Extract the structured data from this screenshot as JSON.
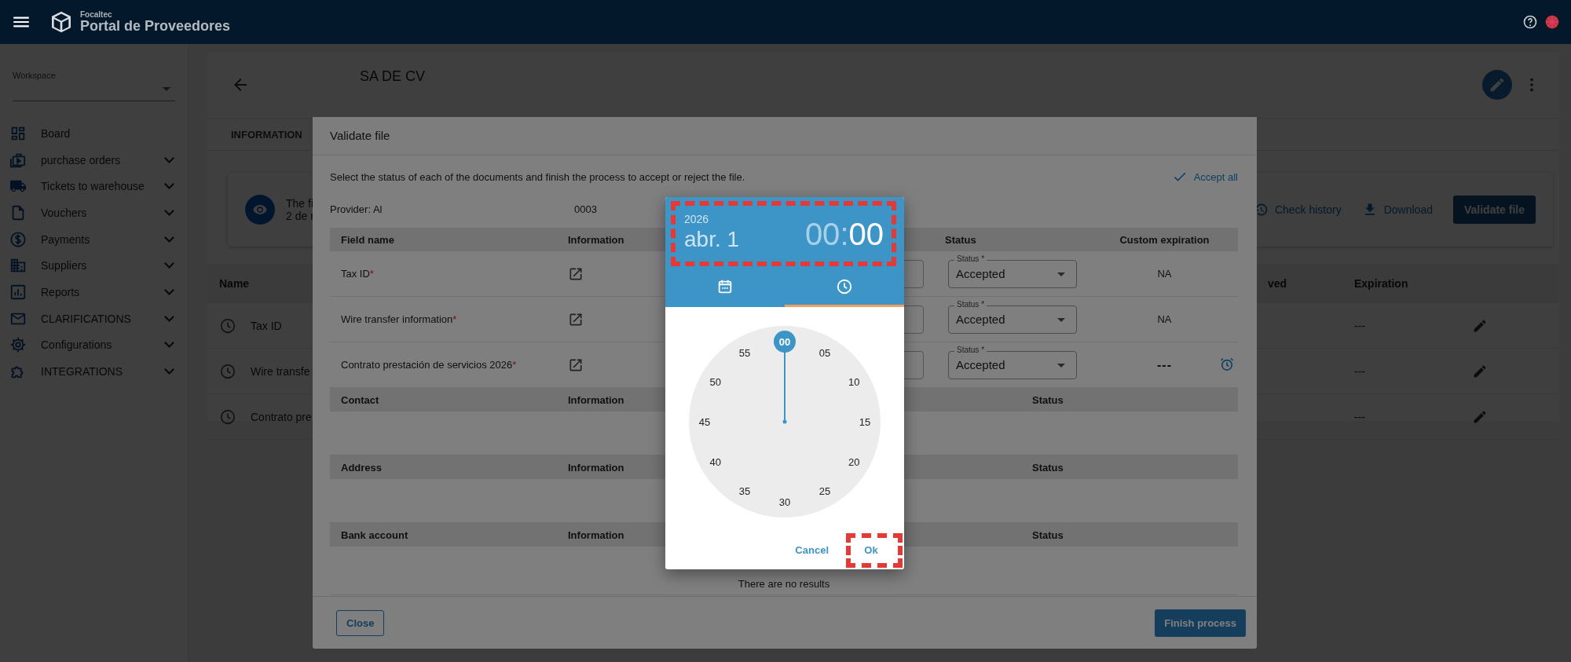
{
  "header": {
    "brand_small": "Focaltec",
    "brand": "Portal de Proveedores"
  },
  "sidebar": {
    "workspace_label": "Workspace",
    "items": [
      {
        "label": "Board",
        "expandable": false
      },
      {
        "label": "purchase orders",
        "expandable": true
      },
      {
        "label": "Tickets to warehouse",
        "expandable": true
      },
      {
        "label": "Vouchers",
        "expandable": true
      },
      {
        "label": "Payments",
        "expandable": true
      },
      {
        "label": "Suppliers",
        "expandable": true
      },
      {
        "label": "Reports",
        "expandable": true
      },
      {
        "label": "CLARIFICATIONS",
        "expandable": true
      },
      {
        "label": "Configurations",
        "expandable": true
      },
      {
        "label": "INTEGRATIONS",
        "expandable": true
      }
    ]
  },
  "page": {
    "title": "SA DE CV",
    "tabs": [
      {
        "label": "INFORMATION"
      }
    ],
    "notice": {
      "line_1": "The fi",
      "line_2": "2 de r"
    },
    "check_history": "Check history",
    "download": "Download",
    "validate_button": "Validate file",
    "table": {
      "columns": [
        "Name",
        "ved",
        "Expiration"
      ],
      "rows": [
        {
          "name": "Tax ID",
          "expiration": "---"
        },
        {
          "name": "Wire transfe",
          "expiration": "---"
        },
        {
          "name": "Contrato pre",
          "expiration": "---"
        }
      ]
    }
  },
  "dialog": {
    "title": "Validate file",
    "description": "Select the status of each of the documents and finish the process to accept or reject the file.",
    "accept_all": "Accept all",
    "provider_label": "Provider: Al",
    "provider_value": "0003",
    "documents": {
      "required_mark": "*",
      "columns": [
        "Field name",
        "Information",
        "Status",
        "Custom expiration"
      ],
      "rows": [
        {
          "name": "Tax ID",
          "required": true,
          "status_label": "Status *",
          "status": "Accepted",
          "custom_expiration": "NA",
          "alarm": false
        },
        {
          "name": "Wire transfer information",
          "required": true,
          "status_label": "Status *",
          "status": "Accepted",
          "custom_expiration": "NA",
          "alarm": false
        },
        {
          "name": "Contrato prestación de servicios 2026",
          "required": true,
          "status_label": "Status *",
          "status": "Accepted",
          "custom_expiration": "---",
          "alarm": true
        }
      ]
    },
    "sections": [
      {
        "title": "Contact",
        "information": "Information",
        "status": "Status"
      },
      {
        "title": "Address",
        "information": "Information",
        "status": "Status"
      },
      {
        "title": "Bank account",
        "information": "Information",
        "status": "Status",
        "empty_text": "There are no results"
      }
    ],
    "close_button": "Close",
    "finish_button": "Finish process"
  },
  "picker": {
    "year": "2026",
    "date": "abr. 1",
    "time_parts": [
      {
        "text": "00",
        "selected": false
      },
      {
        "text": "00",
        "selected": true
      }
    ],
    "separator": ":",
    "tabs": [
      {
        "kind": "calendar",
        "selected": false
      },
      {
        "kind": "clock",
        "selected": true
      }
    ],
    "dial": [
      {
        "label": "00",
        "selected": true
      },
      {
        "label": "05",
        "selected": false
      },
      {
        "label": "10",
        "selected": false
      },
      {
        "label": "15",
        "selected": false
      },
      {
        "label": "20",
        "selected": false
      },
      {
        "label": "25",
        "selected": false
      },
      {
        "label": "30",
        "selected": false
      },
      {
        "label": "35",
        "selected": false
      },
      {
        "label": "40",
        "selected": false
      },
      {
        "label": "45",
        "selected": false
      },
      {
        "label": "50",
        "selected": false
      },
      {
        "label": "55",
        "selected": false
      }
    ],
    "cancel": "Cancel",
    "ok": "Ok",
    "header_highlighted": true,
    "ok_highlighted": true
  }
}
